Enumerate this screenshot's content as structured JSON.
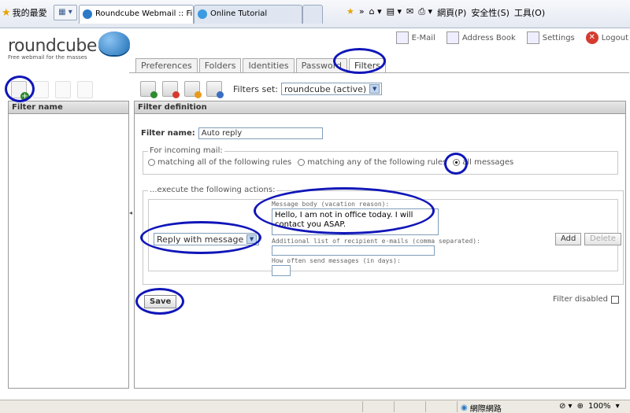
{
  "browser": {
    "favorites_label": "我的最愛",
    "tabs": [
      {
        "title": "Roundcube Webmail :: Fil...",
        "close": "✕"
      },
      {
        "title": "Online Tutorial"
      }
    ],
    "tools": [
      "網頁(P)",
      "安全性(S)",
      "工具(O)"
    ],
    "status_zone": "網際網路",
    "status_zoom": "100%"
  },
  "app": {
    "logo_text": "roundcube",
    "logo_tagline": "Free webmail for the masses",
    "topnav": {
      "email": "E-Mail",
      "address_book": "Address Book",
      "settings": "Settings",
      "logout": "Logout"
    },
    "settings_tabs": [
      "Preferences",
      "Folders",
      "Identities",
      "Password",
      "Filters"
    ],
    "filters_set_label": "Filters set:",
    "filters_set_value": "roundcube (active)",
    "left_panel_header": "Filter name",
    "right_panel_header": "Filter definition",
    "filter_name_label": "Filter name:",
    "filter_name_value": "Auto reply",
    "incoming_legend": "For incoming mail:",
    "rule_options": [
      "matching all of the following rules",
      "matching any of the following rules",
      "all messages"
    ],
    "selected_rule": "all messages",
    "actions_legend": "...execute the following actions:",
    "action_select": "Reply with message",
    "message_body_label": "Message body (vacation reason):",
    "message_body_value": "Hello, I am not in office today. I will contact you ASAP.",
    "recipients_label": "Additional list of recipient e-mails (comma separated):",
    "recipients_value": "",
    "days_label": "How often send messages (in days):",
    "days_value": "",
    "add_button": "Add",
    "delete_button": "Delete",
    "save_button": "Save",
    "filter_disabled_label": "Filter disabled"
  }
}
